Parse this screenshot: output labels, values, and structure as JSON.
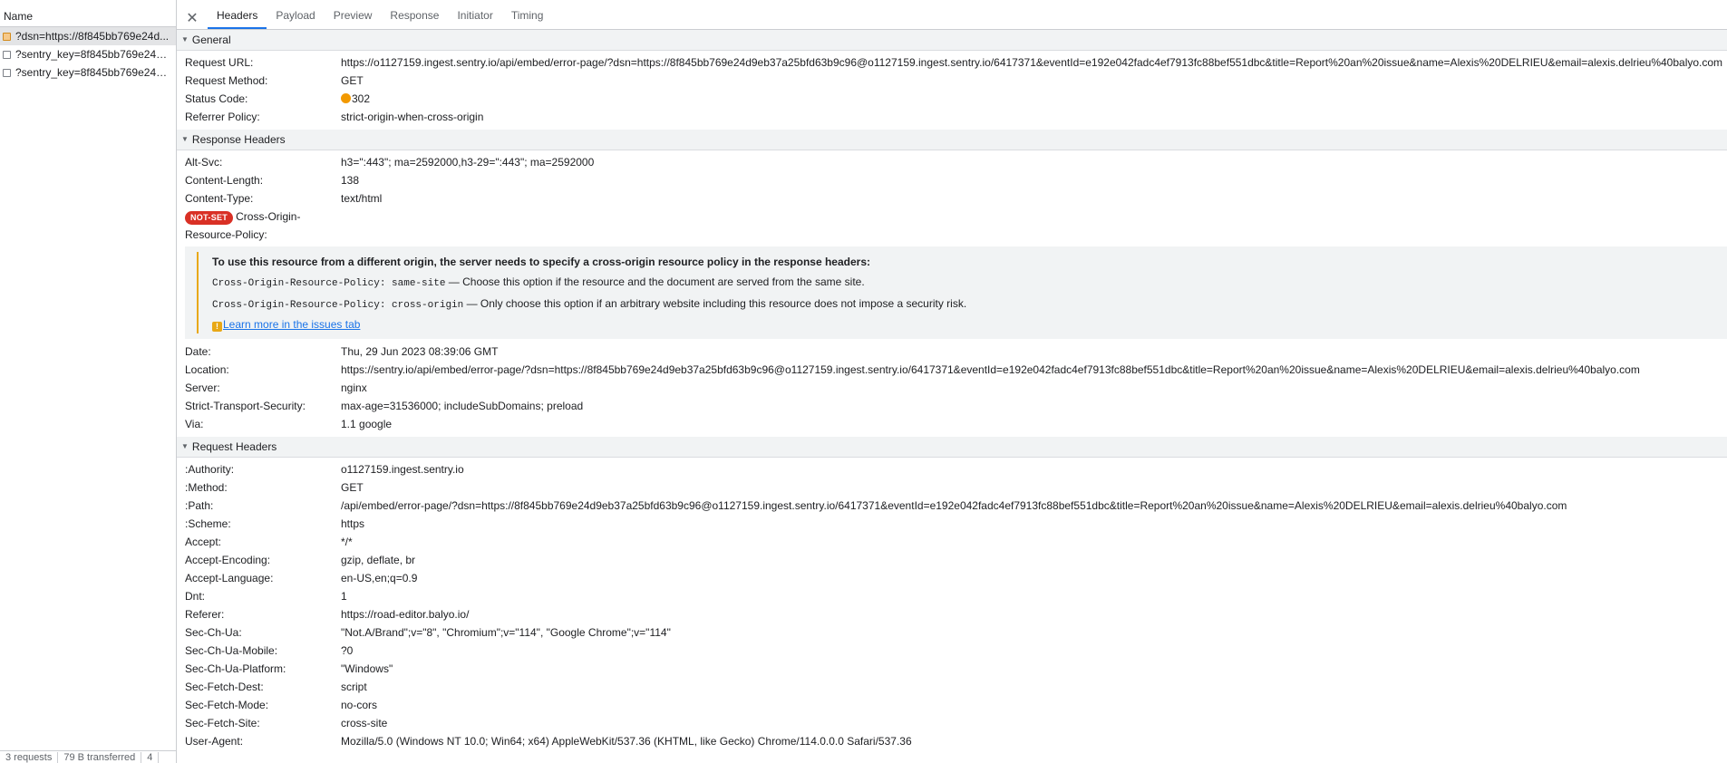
{
  "left": {
    "header": "Name",
    "requests": [
      {
        "name": "?dsn=https://8f845bb769e24d...",
        "icon": "embed-page-icon",
        "selected": true
      },
      {
        "name": "?sentry_key=8f845bb769e24d...",
        "icon": "document-icon",
        "selected": false
      },
      {
        "name": "?sentry_key=8f845bb769e24d...",
        "icon": "document-icon",
        "selected": false
      }
    ],
    "status": {
      "requests": "3 requests",
      "transferred": "79 B transferred",
      "extra": "4"
    }
  },
  "tabs": [
    "Headers",
    "Payload",
    "Preview",
    "Response",
    "Initiator",
    "Timing"
  ],
  "general": {
    "title": "General",
    "rows": [
      {
        "key": "Request URL:",
        "value": "https://o1127159.ingest.sentry.io/api/embed/error-page/?dsn=https://8f845bb769e24d9eb37a25bfd63b9c96@o1127159.ingest.sentry.io/6417371&eventId=e192e042fadc4ef7913fc88bef551dbc&title=Report%20an%20issue&name=Alexis%20DELRIEU&email=alexis.delrieu%40balyo.com"
      },
      {
        "key": "Request Method:",
        "value": "GET"
      },
      {
        "key": "Status Code:",
        "value": "302"
      },
      {
        "key": "Referrer Policy:",
        "value": "strict-origin-when-cross-origin"
      }
    ]
  },
  "response_headers": {
    "title": "Response Headers",
    "rows_top": [
      {
        "key": "Alt-Svc:",
        "value": "h3=\":443\"; ma=2592000,h3-29=\":443\"; ma=2592000"
      },
      {
        "key": "Content-Length:",
        "value": "138"
      },
      {
        "key": "Content-Type:",
        "value": "text/html"
      }
    ],
    "corp": {
      "badge": "NOT-SET",
      "key_line1": "Cross-Origin-",
      "key_line2": "Resource-Policy:",
      "info_title": "To use this resource from a different origin, the server needs to specify a cross-origin resource policy in the response headers:",
      "opt1_code": "Cross-Origin-Resource-Policy: same-site",
      "opt1_text": " — Choose this option if the resource and the document are served from the same site.",
      "opt2_code": "Cross-Origin-Resource-Policy: cross-origin",
      "opt2_text": " — Only choose this option if an arbitrary website including this resource does not impose a security risk.",
      "link": "Learn more in the issues tab"
    },
    "rows_bottom": [
      {
        "key": "Date:",
        "value": "Thu, 29 Jun 2023 08:39:06 GMT"
      },
      {
        "key": "Location:",
        "value": "https://sentry.io/api/embed/error-page/?dsn=https://8f845bb769e24d9eb37a25bfd63b9c96@o1127159.ingest.sentry.io/6417371&eventId=e192e042fadc4ef7913fc88bef551dbc&title=Report%20an%20issue&name=Alexis%20DELRIEU&email=alexis.delrieu%40balyo.com"
      },
      {
        "key": "Server:",
        "value": "nginx"
      },
      {
        "key": "Strict-Transport-Security:",
        "value": "max-age=31536000; includeSubDomains; preload"
      },
      {
        "key": "Via:",
        "value": "1.1 google"
      }
    ]
  },
  "request_headers": {
    "title": "Request Headers",
    "rows": [
      {
        "key": ":Authority:",
        "value": "o1127159.ingest.sentry.io"
      },
      {
        "key": ":Method:",
        "value": "GET"
      },
      {
        "key": ":Path:",
        "value": "/api/embed/error-page/?dsn=https://8f845bb769e24d9eb37a25bfd63b9c96@o1127159.ingest.sentry.io/6417371&eventId=e192e042fadc4ef7913fc88bef551dbc&title=Report%20an%20issue&name=Alexis%20DELRIEU&email=alexis.delrieu%40balyo.com"
      },
      {
        "key": ":Scheme:",
        "value": "https"
      },
      {
        "key": "Accept:",
        "value": "*/*"
      },
      {
        "key": "Accept-Encoding:",
        "value": "gzip, deflate, br"
      },
      {
        "key": "Accept-Language:",
        "value": "en-US,en;q=0.9"
      },
      {
        "key": "Dnt:",
        "value": "1"
      },
      {
        "key": "Referer:",
        "value": "https://road-editor.balyo.io/"
      },
      {
        "key": "Sec-Ch-Ua:",
        "value": "\"Not.A/Brand\";v=\"8\", \"Chromium\";v=\"114\", \"Google Chrome\";v=\"114\""
      },
      {
        "key": "Sec-Ch-Ua-Mobile:",
        "value": "?0"
      },
      {
        "key": "Sec-Ch-Ua-Platform:",
        "value": "\"Windows\""
      },
      {
        "key": "Sec-Fetch-Dest:",
        "value": "script"
      },
      {
        "key": "Sec-Fetch-Mode:",
        "value": "no-cors"
      },
      {
        "key": "Sec-Fetch-Site:",
        "value": "cross-site"
      },
      {
        "key": "User-Agent:",
        "value": "Mozilla/5.0 (Windows NT 10.0; Win64; x64) AppleWebKit/537.36 (KHTML, like Gecko) Chrome/114.0.0.0 Safari/537.36"
      }
    ]
  },
  "colors": {
    "status_dot": "#f29900",
    "badge": "#d93025",
    "link": "#1a73e8",
    "warning": "#e8a817"
  }
}
